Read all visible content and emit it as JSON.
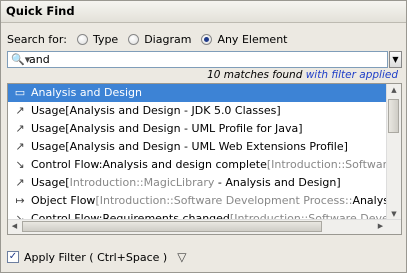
{
  "title": "Quick Find",
  "search": {
    "label": "Search for:",
    "options": [
      {
        "label": "Type",
        "selected": false
      },
      {
        "label": "Diagram",
        "selected": false
      },
      {
        "label": "Any Element",
        "selected": true
      }
    ],
    "value": "and",
    "search_icon": "magnifier-with-dropdown-icon",
    "dropdown_icon": "triangle-down-icon"
  },
  "matches": {
    "count_text": "10 matches found",
    "filter_text": "with filter applied"
  },
  "results": [
    {
      "icon": "package-icon",
      "main": "Analysis and Design",
      "grey": "",
      "tail": "",
      "selected": true
    },
    {
      "icon": "usage-arrow-icon",
      "main": "Usage[Analysis and Design - JDK 5.0 Classes]",
      "grey": "",
      "tail": "",
      "selected": false
    },
    {
      "icon": "usage-arrow-icon",
      "main": "Usage[Analysis and Design - UML Profile for Java]",
      "grey": "",
      "tail": "",
      "selected": false
    },
    {
      "icon": "usage-arrow-icon",
      "main": "Usage[Analysis and Design - UML Web Extensions Profile]",
      "grey": "",
      "tail": "",
      "selected": false
    },
    {
      "icon": "control-flow-icon",
      "main": "Control Flow:Analysis and design complete",
      "grey": "[Introduction::Software Develop",
      "tail": "",
      "selected": false
    },
    {
      "icon": "usage-arrow-icon",
      "main": "Usage[",
      "grey": "Introduction::MagicLibrary",
      "tail": " - Analysis and Design]",
      "selected": false
    },
    {
      "icon": "object-flow-icon",
      "main": "Object Flow",
      "grey": "[Introduction::Software Development Process::",
      "tail": "Analysis and D",
      "selected": false
    },
    {
      "icon": "control-flow-icon",
      "main": "Control Flow:Requirements changed",
      "grey": "[Introduction::Software Development",
      "tail": "",
      "selected": false
    }
  ],
  "footer": {
    "apply_filter_label": "Apply Filter ( Ctrl+Space )",
    "apply_filter_checked": true,
    "filter_icon": "funnel-icon"
  },
  "colors": {
    "selection": "#3d83d5",
    "link": "#1f3fc8"
  }
}
